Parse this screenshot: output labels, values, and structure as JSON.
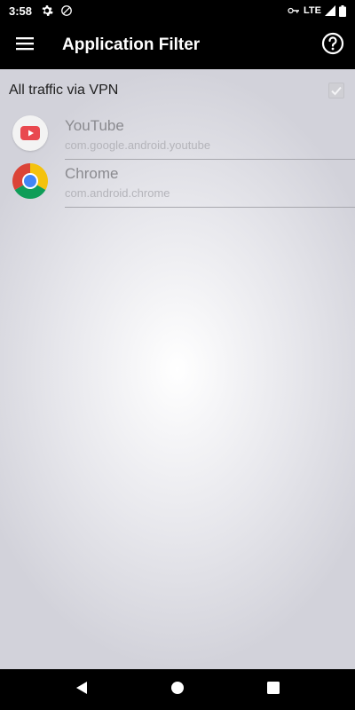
{
  "status_bar": {
    "time": "3:58",
    "network": "LTE",
    "icons": [
      "settings-icon",
      "no-sync-icon",
      "vpn-key-icon",
      "signal-icon",
      "battery-icon"
    ]
  },
  "app_bar": {
    "title": "Application Filter",
    "menu_icon": "hamburger-menu-icon",
    "help_icon": "help-icon"
  },
  "vpn_toggle": {
    "label": "All traffic via VPN",
    "checked": true
  },
  "apps": [
    {
      "name": "YouTube",
      "package": "com.google.android.youtube",
      "icon": "youtube-icon"
    },
    {
      "name": "Chrome",
      "package": "com.android.chrome",
      "icon": "chrome-icon"
    }
  ],
  "nav_bar": {
    "icons": [
      "back-icon",
      "home-icon",
      "recents-icon"
    ]
  },
  "colors": {
    "bars": "#000000",
    "youtube_red": "#e9494f",
    "chrome_red": "#db4437",
    "chrome_yellow": "#f4c20d",
    "chrome_green": "#0f9d58",
    "chrome_blue": "#4285f4"
  }
}
